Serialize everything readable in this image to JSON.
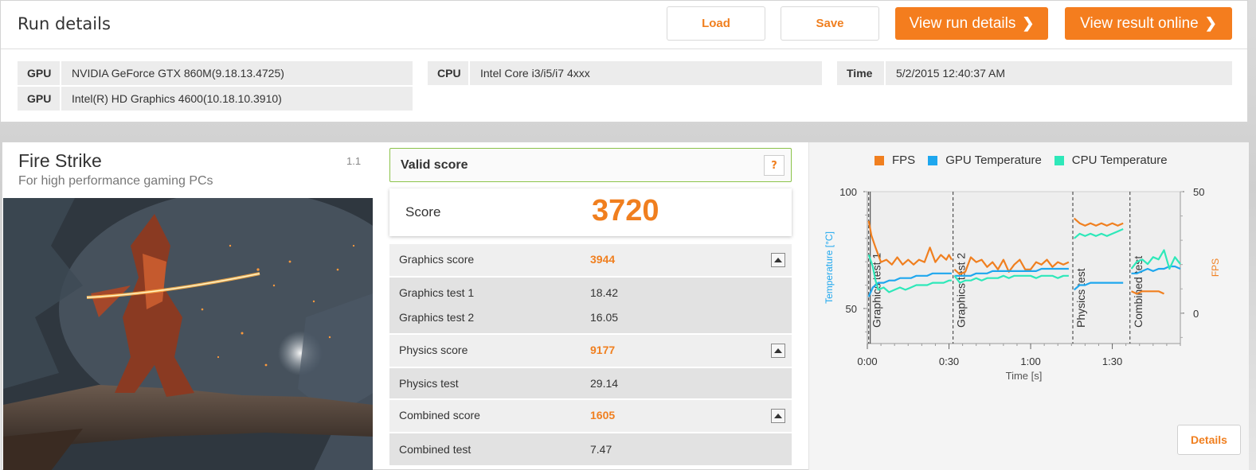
{
  "top": {
    "title": "Run details",
    "load_label": "Load",
    "save_label": "Save",
    "view_run_label": "View run details",
    "view_online_label": "View result online",
    "chevron": "❯",
    "gpu_rows": [
      {
        "key": "GPU",
        "value": "NVIDIA GeForce GTX 860M(9.18.13.4725)"
      },
      {
        "key": "GPU",
        "value": "Intel(R) HD Graphics 4600(10.18.10.3910)"
      }
    ],
    "cpu": {
      "key": "CPU",
      "value": "Intel Core i3/i5/i7 4xxx"
    },
    "time": {
      "key": "Time",
      "value": "5/2/2015 12:40:37 AM"
    }
  },
  "bench": {
    "name": "Fire Strike",
    "subtitle": "For high performance gaming PCs",
    "version": "1.1",
    "valid_label": "Valid score",
    "help_label": "?",
    "score_label": "Score",
    "score_value": "3720",
    "rows": {
      "graphics_score": {
        "label": "Graphics score",
        "value": "3944"
      },
      "graphics_test_1": {
        "label": "Graphics test 1",
        "value": "18.42"
      },
      "graphics_test_2": {
        "label": "Graphics test 2",
        "value": "16.05"
      },
      "physics_score": {
        "label": "Physics score",
        "value": "9177"
      },
      "physics_test": {
        "label": "Physics test",
        "value": "29.14"
      },
      "combined_score": {
        "label": "Combined score",
        "value": "1605"
      },
      "combined_test": {
        "label": "Combined test",
        "value": "7.47"
      }
    },
    "details_label": "Details"
  },
  "colors": {
    "accent": "#f47d1e",
    "fps": "#f07f1f",
    "gpu_temp": "#1ea7ee",
    "cpu_temp": "#2ee8b9",
    "valid": "#8bc34a"
  },
  "chart_data": {
    "type": "line",
    "legend": [
      "FPS",
      "GPU Temperature",
      "CPU Temperature"
    ],
    "xlabel": "Time [s]",
    "ylabel_left": "Temperature [°C]",
    "ylabel_right": "FPS",
    "x_ticks": [
      "0:00",
      "0:30",
      "1:00",
      "1:30"
    ],
    "x_range": [
      0,
      115
    ],
    "y_left_ticks": [
      "100",
      "50"
    ],
    "y_left_range": [
      35,
      100
    ],
    "y_right_ticks": [
      "50",
      "0"
    ],
    "y_right_range": [
      -12.5,
      50
    ],
    "test_markers": [
      {
        "label": "Graphics test 1",
        "x": 0.5
      },
      {
        "label": "Graphics test 2",
        "x": 31.5
      },
      {
        "label": "Physics test",
        "x": 75.5
      },
      {
        "label": "Combined test",
        "x": 96.5
      }
    ],
    "series": [
      {
        "name": "FPS",
        "axis": "right",
        "segments": [
          [
            [
              0.5,
              38
            ],
            [
              1.5,
              32
            ],
            [
              3,
              27
            ],
            [
              5,
              21
            ],
            [
              7,
              22
            ],
            [
              9,
              20
            ],
            [
              11,
              23
            ],
            [
              13,
              20
            ],
            [
              15,
              22
            ],
            [
              17,
              20
            ],
            [
              19,
              22
            ],
            [
              21,
              21
            ],
            [
              23,
              27
            ],
            [
              25,
              21
            ],
            [
              27,
              24
            ],
            [
              29,
              22
            ],
            [
              30,
              24
            ],
            [
              31,
              22
            ]
          ],
          [
            [
              32,
              18
            ],
            [
              34,
              16
            ],
            [
              36,
              17
            ],
            [
              38,
              23
            ],
            [
              40,
              21
            ],
            [
              42,
              22
            ],
            [
              44,
              19
            ],
            [
              46,
              21
            ],
            [
              48,
              18
            ],
            [
              50,
              22
            ],
            [
              52,
              17
            ],
            [
              54,
              20
            ],
            [
              56,
              22
            ],
            [
              58,
              18
            ],
            [
              60,
              18
            ],
            [
              62,
              21
            ],
            [
              64,
              20
            ],
            [
              66,
              22
            ],
            [
              68,
              19
            ],
            [
              70,
              21
            ],
            [
              72,
              20
            ],
            [
              74,
              21
            ]
          ],
          [
            [
              76,
              39
            ],
            [
              78,
              37
            ],
            [
              80,
              36
            ],
            [
              82,
              37
            ],
            [
              84,
              36
            ],
            [
              86,
              37
            ],
            [
              88,
              36
            ],
            [
              90,
              37
            ],
            [
              92,
              36
            ],
            [
              94,
              37
            ]
          ],
          [
            [
              97,
              9
            ],
            [
              99,
              8
            ],
            [
              101,
              9
            ],
            [
              103,
              9
            ],
            [
              105,
              9
            ],
            [
              107,
              9
            ],
            [
              109,
              8
            ]
          ]
        ]
      },
      {
        "name": "GPU Temperature",
        "axis": "left",
        "segments": [
          [
            [
              0.5,
              55
            ],
            [
              2,
              59
            ],
            [
              4,
              61
            ],
            [
              6,
              61
            ],
            [
              8,
              62
            ],
            [
              10,
              62
            ],
            [
              12,
              63
            ],
            [
              14,
              63
            ],
            [
              16,
              63
            ],
            [
              18,
              64
            ],
            [
              20,
              64
            ],
            [
              22,
              64
            ],
            [
              24,
              65
            ],
            [
              26,
              65
            ],
            [
              28,
              65
            ],
            [
              30,
              65
            ],
            [
              31,
              65
            ]
          ],
          [
            [
              32,
              64
            ],
            [
              34,
              64
            ],
            [
              36,
              64
            ],
            [
              38,
              64
            ],
            [
              40,
              65
            ],
            [
              42,
              65
            ],
            [
              44,
              65
            ],
            [
              46,
              66
            ],
            [
              48,
              66
            ],
            [
              50,
              66
            ],
            [
              52,
              66
            ],
            [
              54,
              66
            ],
            [
              56,
              66
            ],
            [
              58,
              66
            ],
            [
              60,
              66
            ],
            [
              62,
              66
            ],
            [
              64,
              67
            ],
            [
              66,
              67
            ],
            [
              68,
              67
            ],
            [
              70,
              67
            ],
            [
              72,
              67
            ],
            [
              74,
              67
            ]
          ],
          [
            [
              76,
              58
            ],
            [
              78,
              60
            ],
            [
              80,
              60
            ],
            [
              82,
              61
            ],
            [
              84,
              61
            ],
            [
              86,
              61
            ],
            [
              88,
              61
            ],
            [
              90,
              61
            ],
            [
              92,
              61
            ],
            [
              94,
              61
            ]
          ],
          [
            [
              97,
              65
            ],
            [
              99,
              65
            ],
            [
              101,
              66
            ],
            [
              103,
              67
            ],
            [
              105,
              66
            ],
            [
              107,
              67
            ],
            [
              109,
              67
            ],
            [
              111,
              68
            ],
            [
              113,
              68
            ],
            [
              115,
              67
            ]
          ]
        ]
      },
      {
        "name": "CPU Temperature",
        "axis": "left",
        "segments": [
          [
            [
              0.5,
              73
            ],
            [
              2,
              68
            ],
            [
              3,
              62
            ],
            [
              4,
              58
            ],
            [
              6,
              59
            ],
            [
              8,
              57
            ],
            [
              10,
              58
            ],
            [
              12,
              59
            ],
            [
              14,
              58
            ],
            [
              16,
              59
            ],
            [
              18,
              60
            ],
            [
              20,
              60
            ],
            [
              22,
              60
            ],
            [
              24,
              61
            ],
            [
              26,
              61
            ],
            [
              28,
              61
            ],
            [
              30,
              62
            ],
            [
              31,
              62
            ]
          ],
          [
            [
              32,
              64
            ],
            [
              34,
              61
            ],
            [
              36,
              62
            ],
            [
              38,
              62
            ],
            [
              40,
              63
            ],
            [
              42,
              62
            ],
            [
              44,
              63
            ],
            [
              46,
              63
            ],
            [
              48,
              63
            ],
            [
              50,
              64
            ],
            [
              52,
              63
            ],
            [
              54,
              64
            ],
            [
              56,
              64
            ],
            [
              58,
              64
            ],
            [
              60,
              64
            ],
            [
              62,
              63
            ],
            [
              64,
              64
            ],
            [
              66,
              64
            ],
            [
              68,
              64
            ],
            [
              70,
              63
            ],
            [
              72,
              64
            ],
            [
              74,
              64
            ]
          ],
          [
            [
              76,
              80
            ],
            [
              78,
              82
            ],
            [
              80,
              81
            ],
            [
              82,
              82
            ],
            [
              84,
              81
            ],
            [
              86,
              82
            ],
            [
              88,
              81
            ],
            [
              90,
              82
            ],
            [
              92,
              83
            ],
            [
              94,
              84
            ]
          ],
          [
            [
              97,
              67
            ],
            [
              99,
              70
            ],
            [
              101,
              71
            ],
            [
              103,
              69
            ],
            [
              105,
              72
            ],
            [
              107,
              71
            ],
            [
              109,
              75
            ],
            [
              111,
              67
            ],
            [
              113,
              72
            ],
            [
              115,
              69
            ]
          ]
        ]
      }
    ]
  }
}
